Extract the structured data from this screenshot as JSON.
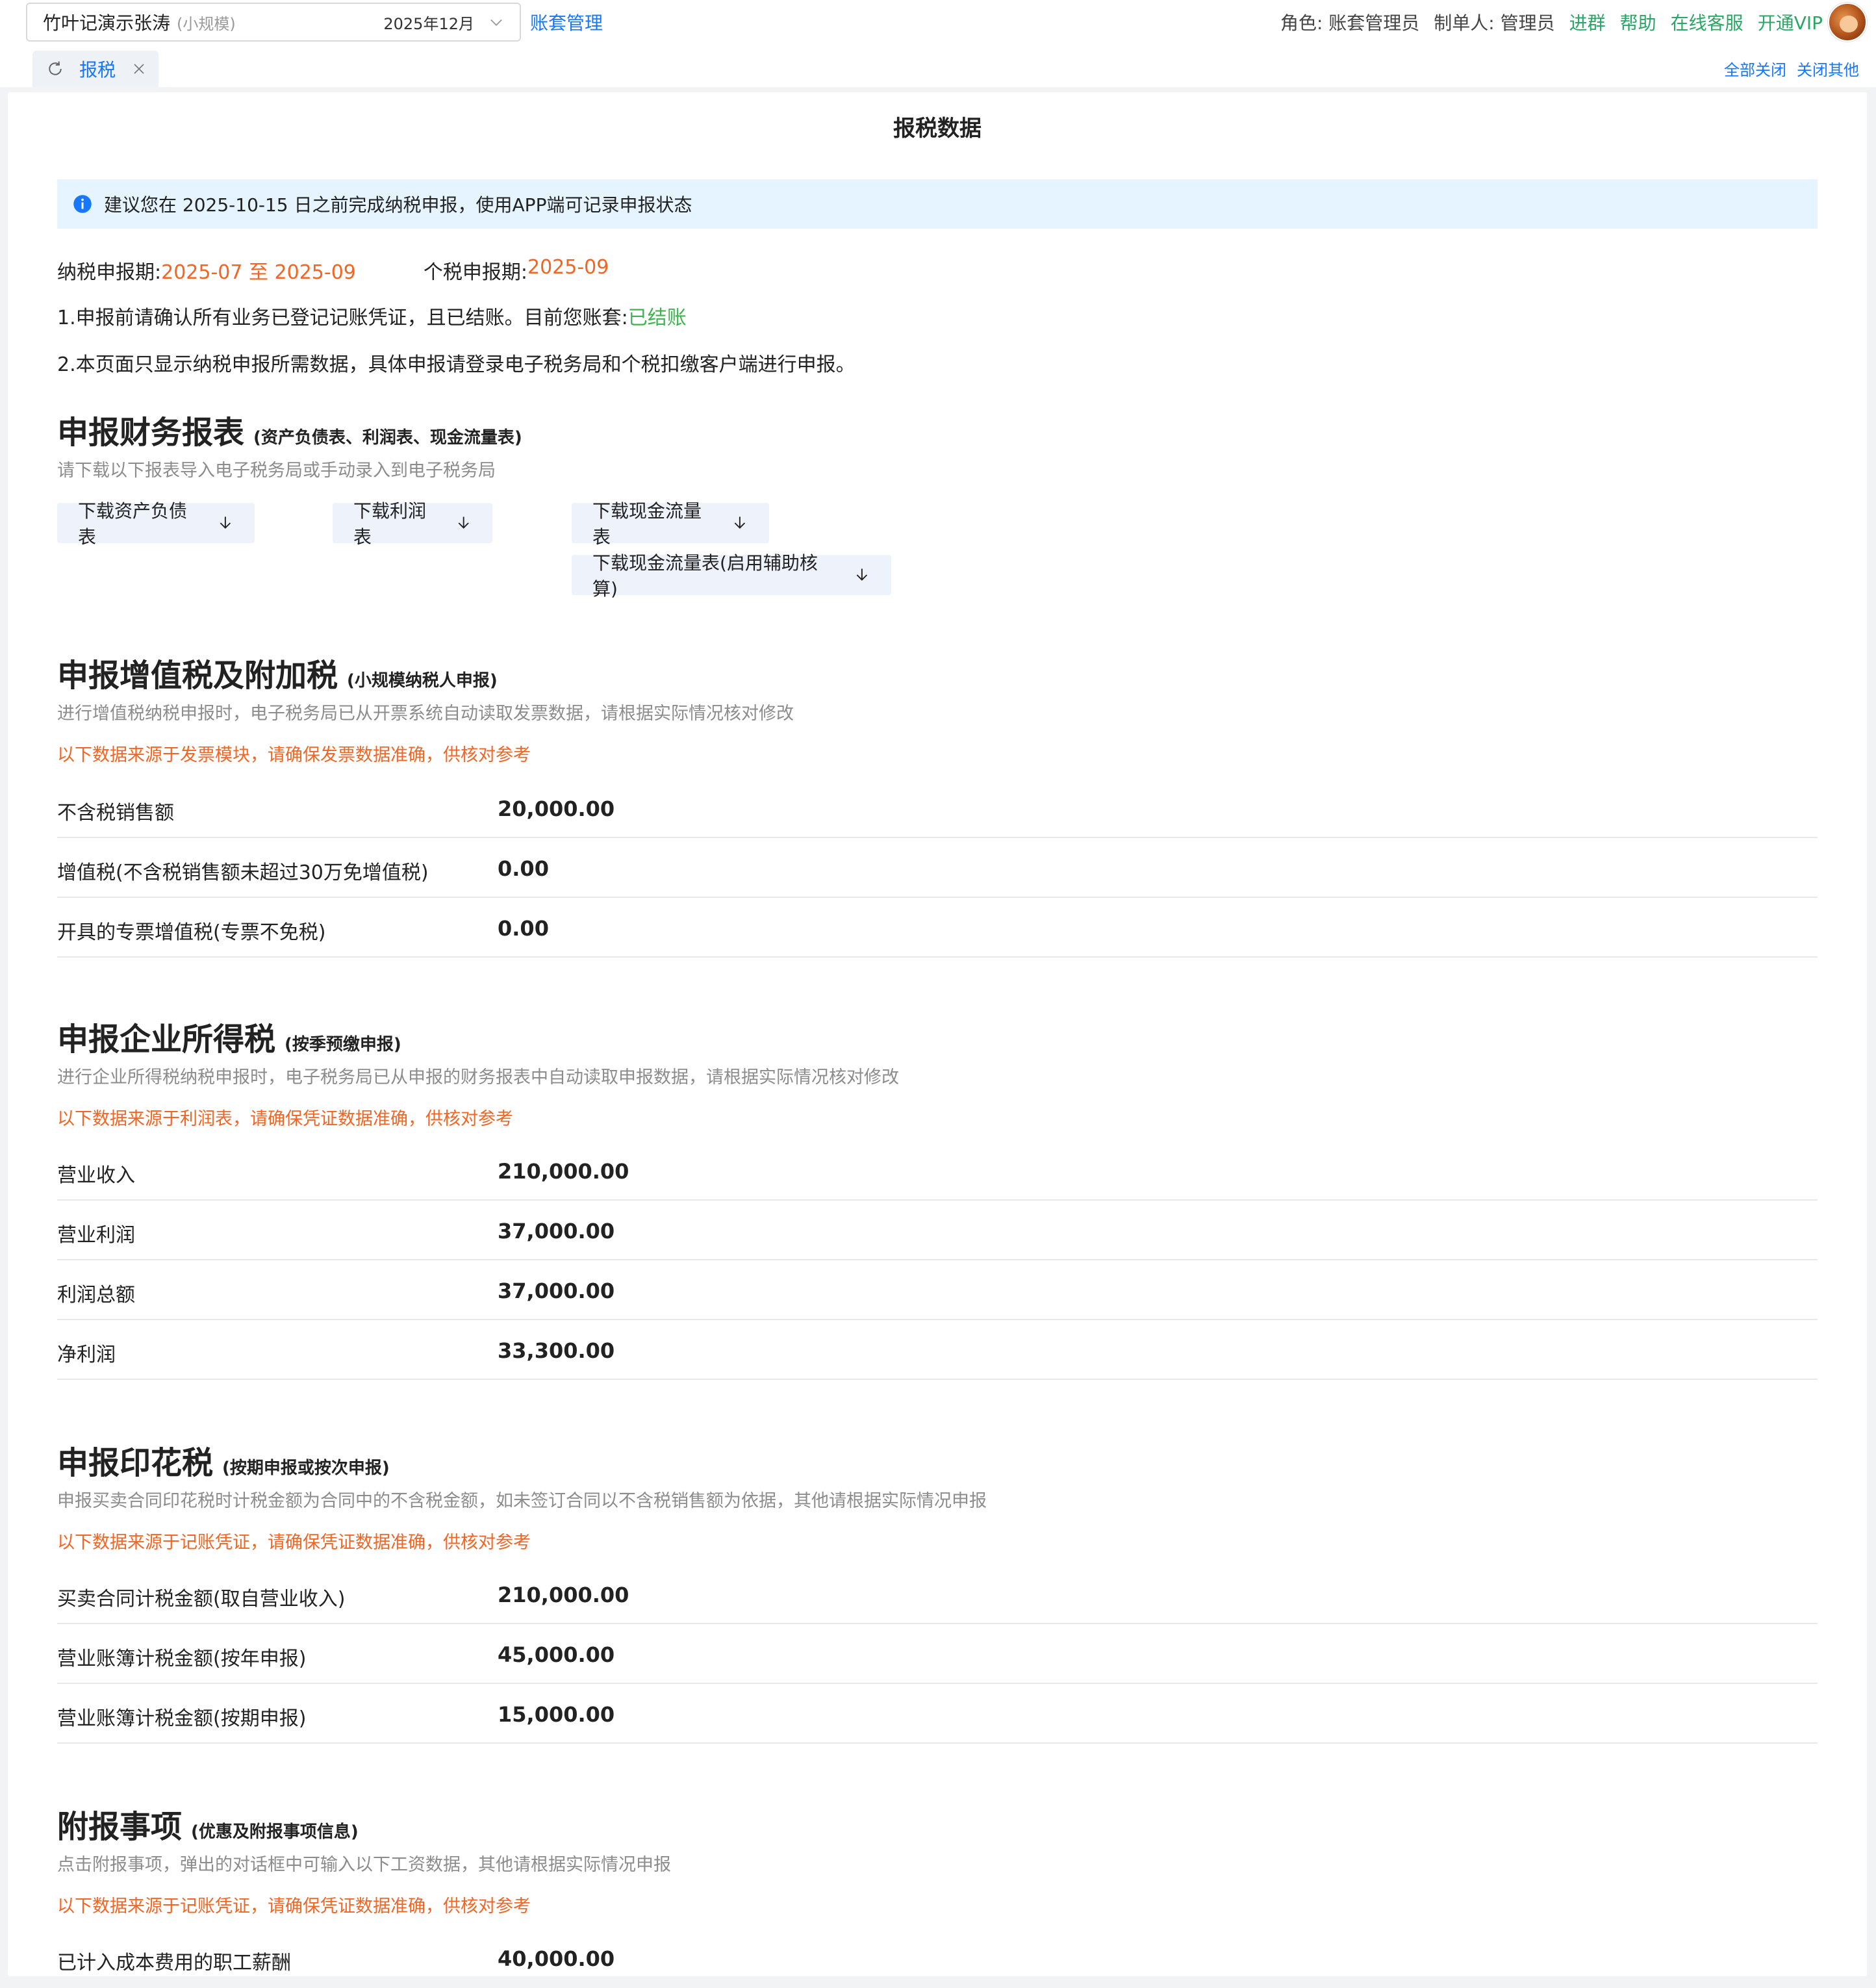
{
  "topbar": {
    "account_name": "竹叶记演示张涛",
    "account_scale": "(小规模)",
    "period": "2025年12月",
    "manage_link": "账套管理",
    "role": "角色: 账套管理员",
    "maker": "制单人: 管理员",
    "join_group": "进群",
    "help": "帮助",
    "online_service": "在线客服",
    "open_vip": "开通VIP"
  },
  "tabs": {
    "active_tab": "报税",
    "close_all": "全部关闭",
    "close_others": "关闭其他"
  },
  "page": {
    "title": "报税数据",
    "notice": "建议您在 2025-10-15 日之前完成纳税申报，使用APP端可记录申报状态",
    "tax_period_label": "纳税申报期:",
    "tax_period_value": "2025-07 至 2025-09",
    "personal_period_label": "个税申报期:",
    "personal_period_value": "2025-09",
    "line1_prefix": "1.申报前请确认所有业务已登记记账凭证，且已结账。目前您账套:",
    "line1_status": "已结账",
    "line2": "2.本页面只显示纳税申报所需数据，具体申报请登录电子税务局和个税扣缴客户端进行申报。"
  },
  "financial": {
    "title": "申报财务报表",
    "subtitle": "(资产负债表、利润表、现金流量表)",
    "desc": "请下载以下报表导入电子税务局或手动录入到电子税务局",
    "buttons": [
      "下载资产负债表",
      "下载利润表",
      "下载现金流量表",
      "下载现金流量表(启用辅助核算)"
    ]
  },
  "vat": {
    "title": "申报增值税及附加税",
    "subtitle": "(小规模纳税人申报)",
    "desc": "进行增值税纳税申报时，电子税务局已从开票系统自动读取发票数据，请根据实际情况核对修改",
    "warn": "以下数据来源于发票模块，请确保发票数据准确，供核对参考",
    "rows": [
      {
        "label": "不含税销售额",
        "value": "20,000.00"
      },
      {
        "label": "增值税(不含税销售额未超过30万免增值税)",
        "value": "0.00"
      },
      {
        "label": "开具的专票增值税(专票不免税)",
        "value": "0.00"
      }
    ]
  },
  "cit": {
    "title": "申报企业所得税",
    "subtitle": "(按季预缴申报)",
    "desc": "进行企业所得税纳税申报时，电子税务局已从申报的财务报表中自动读取申报数据，请根据实际情况核对修改",
    "warn": "以下数据来源于利润表，请确保凭证数据准确，供核对参考",
    "rows": [
      {
        "label": "营业收入",
        "value": "210,000.00"
      },
      {
        "label": "营业利润",
        "value": "37,000.00"
      },
      {
        "label": "利润总额",
        "value": "37,000.00"
      },
      {
        "label": "净利润",
        "value": "33,300.00"
      }
    ]
  },
  "stamp": {
    "title": "申报印花税",
    "subtitle": "(按期申报或按次申报)",
    "desc": "申报买卖合同印花税时计税金额为合同中的不含税金额，如未签订合同以不含税销售额为依据，其他请根据实际情况申报",
    "warn": "以下数据来源于记账凭证，请确保凭证数据准确，供核对参考",
    "rows": [
      {
        "label": "买卖合同计税金额(取自营业收入)",
        "value": "210,000.00"
      },
      {
        "label": "营业账簿计税金额(按年申报)",
        "value": "45,000.00"
      },
      {
        "label": "营业账簿计税金额(按期申报)",
        "value": "15,000.00"
      }
    ]
  },
  "extra": {
    "title": "附报事项",
    "subtitle": "(优惠及附报事项信息)",
    "desc": "点击附报事项，弹出的对话框中可输入以下工资数据，其他请根据实际情况申报",
    "warn": "以下数据来源于记账凭证，请确保凭证数据准确，供核对参考",
    "rows": [
      {
        "label": "已计入成本费用的职工薪酬",
        "value": "40,000.00"
      }
    ]
  },
  "colors": {
    "link_blue": "#1677ff",
    "green": "#2aa766",
    "orange": "#f26522",
    "notice_bg": "#e6f4ff"
  }
}
